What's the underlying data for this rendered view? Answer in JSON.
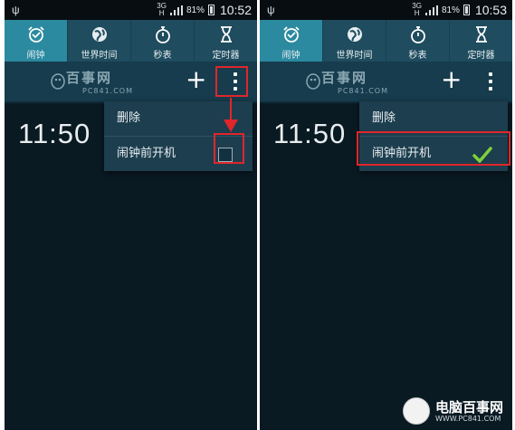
{
  "status_bar": {
    "network": "3G",
    "network_sub": "H",
    "battery_percent": "81%",
    "left_time": "10:52",
    "right_time": "10:53"
  },
  "tabs": [
    {
      "label": "闹钟",
      "icon": "alarm-clock-icon"
    },
    {
      "label": "世界时间",
      "icon": "globe-icon"
    },
    {
      "label": "秒表",
      "icon": "stopwatch-icon"
    },
    {
      "label": "定时器",
      "icon": "hourglass-icon"
    }
  ],
  "watermark": {
    "cn": "百事网",
    "en": "PC841.COM"
  },
  "toolbar": {
    "add_label": "+"
  },
  "alarm": {
    "time": "11:50"
  },
  "menu": {
    "delete_label": "删除",
    "power_on_label": "闹钟前开机"
  },
  "state": {
    "left_checkbox_checked": false,
    "right_checkbox_checked": true
  },
  "footer": {
    "cn": "电脑百事网",
    "en": "WWW.PC841.COM"
  },
  "colors": {
    "accent_tab": "#2b8aa0",
    "tab_bar": "#1f4c5e",
    "highlight": "#e0262a",
    "check": "#7ed13a"
  }
}
